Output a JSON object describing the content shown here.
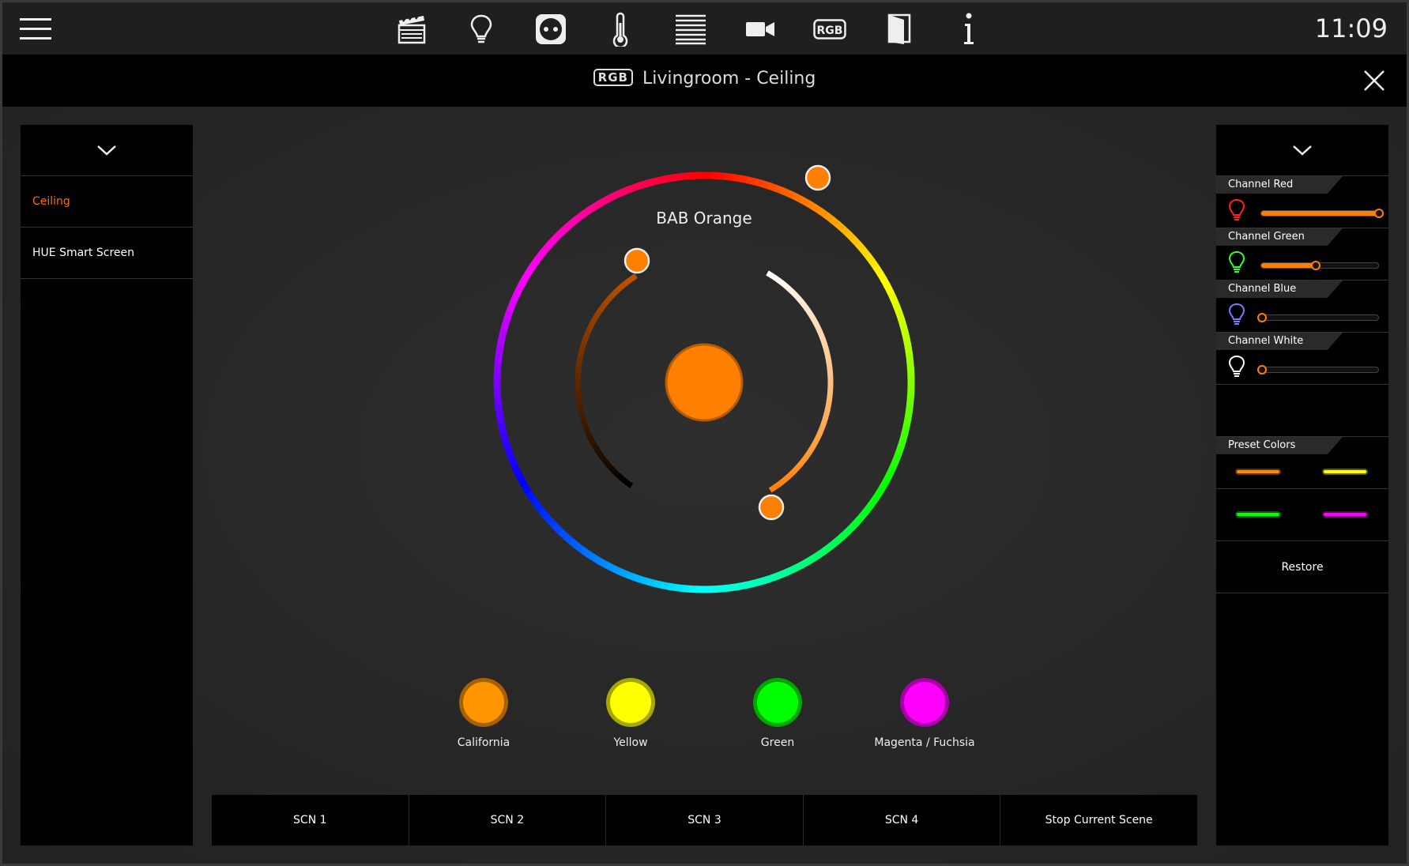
{
  "header": {
    "clock": "11:09",
    "icons": [
      "menu-icon",
      "scenes-icon",
      "light-bulb-icon",
      "socket-icon",
      "thermometer-icon",
      "blinds-icon",
      "camera-icon",
      "rgb-icon",
      "door-icon",
      "info-icon"
    ]
  },
  "titlebar": {
    "badge": "RGB",
    "title": "Livingroom - Ceiling"
  },
  "left_panel": {
    "items": [
      {
        "label": "Ceiling",
        "active": true
      },
      {
        "label": "HUE Smart Screen",
        "active": false
      }
    ]
  },
  "wheel": {
    "color_name": "BAB Orange",
    "color": "#ff7f00"
  },
  "presets": [
    {
      "label": "California",
      "color": "#ff9500"
    },
    {
      "label": "Yellow",
      "color": "#ffff00"
    },
    {
      "label": "Green",
      "color": "#00ff00"
    },
    {
      "label": "Magenta / Fuchsia",
      "color": "#ff00ff"
    }
  ],
  "scenes": [
    "SCN 1",
    "SCN 2",
    "SCN 3",
    "SCN 4",
    "Stop Current Scene"
  ],
  "right_panel": {
    "channels": [
      {
        "label": "Channel Red",
        "value": 1.0,
        "bulb_color": "#ff2020"
      },
      {
        "label": "Channel Green",
        "value": 0.46,
        "bulb_color": "#30ff30"
      },
      {
        "label": "Channel Blue",
        "value": 0.0,
        "bulb_color": "#7a7aff"
      },
      {
        "label": "Channel White",
        "value": 0.0,
        "bulb_color": "#ffffff"
      }
    ],
    "preset_colors_label": "Preset Colors",
    "preset_colors": [
      "#ff8c00",
      "#ffff00",
      "#00ff00",
      "#ff00ff"
    ],
    "restore_label": "Restore"
  }
}
